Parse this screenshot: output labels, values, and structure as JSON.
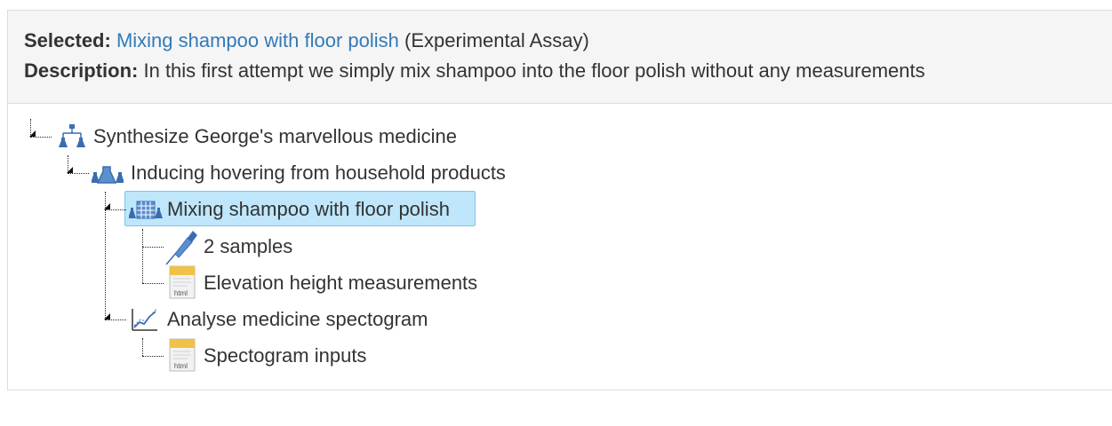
{
  "selection": {
    "selected_label": "Selected:",
    "selected_name": "Mixing shampoo with floor polish",
    "selected_type": "(Experimental Assay)",
    "description_label": "Description:",
    "description_text": "In this first attempt we simply mix shampoo into the floor polish without any measurements"
  },
  "tree": {
    "nodes": [
      {
        "label": "Synthesize George's marvellous medicine",
        "icon": "investigation-icon"
      },
      {
        "label": "Inducing hovering from household products",
        "icon": "study-icon"
      },
      {
        "label": "Mixing shampoo with floor polish",
        "icon": "assay-icon",
        "selected": true
      },
      {
        "label": "2 samples",
        "icon": "pipette-icon"
      },
      {
        "label": "Elevation height measurements",
        "icon": "html-file-icon",
        "file_badge": "html"
      },
      {
        "label": "Analyse medicine spectogram",
        "icon": "analysis-chart-icon"
      },
      {
        "label": "Spectogram inputs",
        "icon": "html-file-icon",
        "file_badge": "html"
      }
    ]
  },
  "colors": {
    "link": "#337ab7",
    "selected_bg": "#bfe6fb",
    "selected_border": "#7cc6ee",
    "header_bg": "#f5f5f5",
    "icon_blue": "#3a6db0"
  }
}
